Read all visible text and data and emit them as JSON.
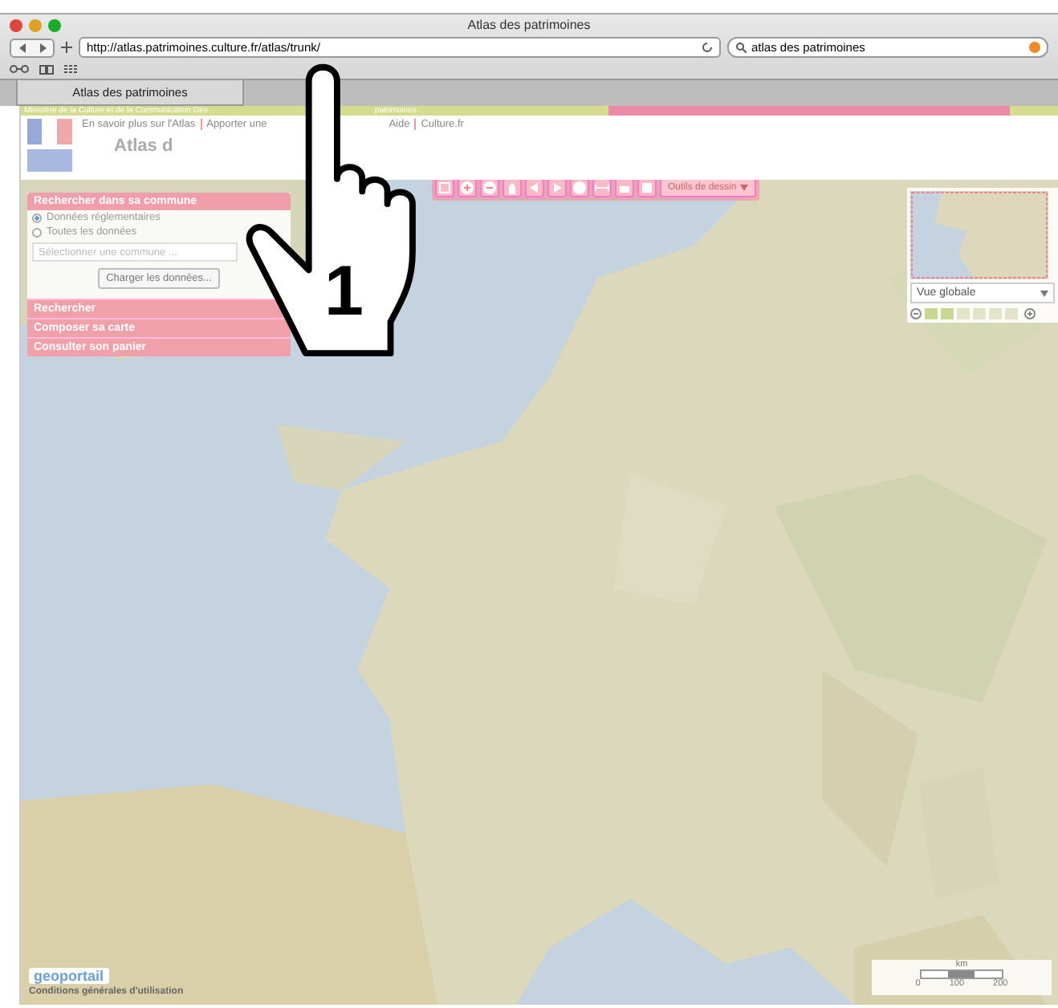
{
  "window": {
    "title": "Atlas des patrimoines"
  },
  "toolbar": {
    "url": "http://atlas.patrimoines.culture.fr/atlas/trunk/",
    "search": "atlas des patrimoines"
  },
  "tabs": [
    {
      "label": "Atlas des patrimoines",
      "selected": true
    }
  ],
  "site": {
    "banner": "Ministère de la Culture et de la Communication Dire",
    "banner_tail": "patrimoines",
    "links": [
      "En savoir plus sur l'Atlas",
      "Apporter une",
      "Aide",
      "Culture.fr"
    ],
    "title": "Atlas d"
  },
  "panel": {
    "heading": "Rechercher dans sa commune",
    "options": [
      {
        "label": "Données réglementaires",
        "selected": true
      },
      {
        "label": "Toutes les données",
        "selected": false
      }
    ],
    "commune_select": {
      "placeholder": "Sélectionner une commune ..."
    },
    "load_button": "Charger les données...",
    "sections": [
      "Rechercher",
      "Composer sa carte",
      "Consulter son panier"
    ]
  },
  "map_tools": {
    "drawing_menu": "Outils de dessin"
  },
  "overview": {
    "view_select": "Vue globale",
    "zoom": {
      "level": 0.33
    }
  },
  "footer": {
    "logo": "geoportail",
    "terms": "Conditions générales d'utilisation"
  },
  "scale": {
    "unit": "km",
    "ticks": [
      "0",
      "100",
      "200"
    ]
  },
  "callout": {
    "number": "1"
  }
}
